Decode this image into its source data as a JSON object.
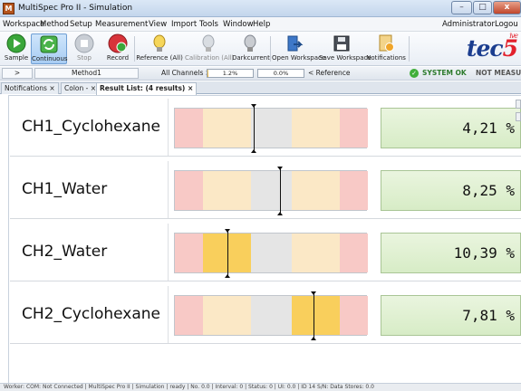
{
  "window": {
    "title": "MultiSpec Pro II - Simulation",
    "icon_text": "M",
    "minimize": "–",
    "maximize": "□",
    "close": "x"
  },
  "menu": {
    "items": [
      "Workspace",
      "Method",
      "Setup",
      "Measurement",
      "View",
      "Import",
      "Tools",
      "Window",
      "Help"
    ],
    "user": "Administrator",
    "logout": "Logou"
  },
  "toolbar": {
    "buttons": [
      {
        "label": "Sample",
        "icon": "play-icon"
      },
      {
        "label": "Continuous",
        "icon": "continuous-refresh-icon"
      },
      {
        "label": "Stop",
        "icon": "stop-icon"
      },
      {
        "label": "Record",
        "icon": "record-icon"
      },
      {
        "label": "Reference (All)",
        "icon": "lightbulb-icon"
      },
      {
        "label": "Calibration (All)",
        "icon": "calibration-icon"
      },
      {
        "label": "Darkcurrent",
        "icon": "dark-lightbulb-icon"
      },
      {
        "label": "Open Workspace",
        "icon": "open-workspace-icon"
      },
      {
        "label": "Save Workspace",
        "icon": "save-icon"
      },
      {
        "label": "Notifications",
        "icon": "notifications-icon"
      }
    ],
    "logo_text": "tec",
    "logo_accent": "5",
    "logo_tag": "ive"
  },
  "strip": {
    "expand": ">",
    "method": "Method1",
    "channels_label": "All Channels >",
    "progress1_label": "1.2%",
    "progress1_value": 0.012,
    "progress2_label": "0.0%",
    "progress2_value": 0.0,
    "reference_label": "< Reference",
    "system_status": "SYSTEM OK",
    "measure_status": "NOT MEASURING"
  },
  "tabs": [
    {
      "label": "Notifications ×",
      "active": false
    },
    {
      "label": "Colon - ×",
      "active": false
    },
    {
      "label": "Result List: (4 results) ×",
      "active": true
    }
  ],
  "results": [
    {
      "name": "CH1_Cyclohexane",
      "value": "4,21 %",
      "needle": 0.41,
      "highlight": null
    },
    {
      "name": "CH1_Water",
      "value": "8,25 %",
      "needle": 0.545,
      "highlight": null
    },
    {
      "name": "CH2_Water",
      "value": "10,39 %",
      "needle": 0.27,
      "highlight": "left"
    },
    {
      "name": "CH2_Cyclohexane",
      "value": "7,81 %",
      "needle": 0.72,
      "highlight": "right"
    }
  ],
  "statusbar": "Worker: COM: Not Connected | MultiSpec Pro II | Simulation | ready | No. 0.0 | Interval: 0 | Status: 0 | UI: 0.0 | ID 14 S/N: Data Stores: 0.0"
}
